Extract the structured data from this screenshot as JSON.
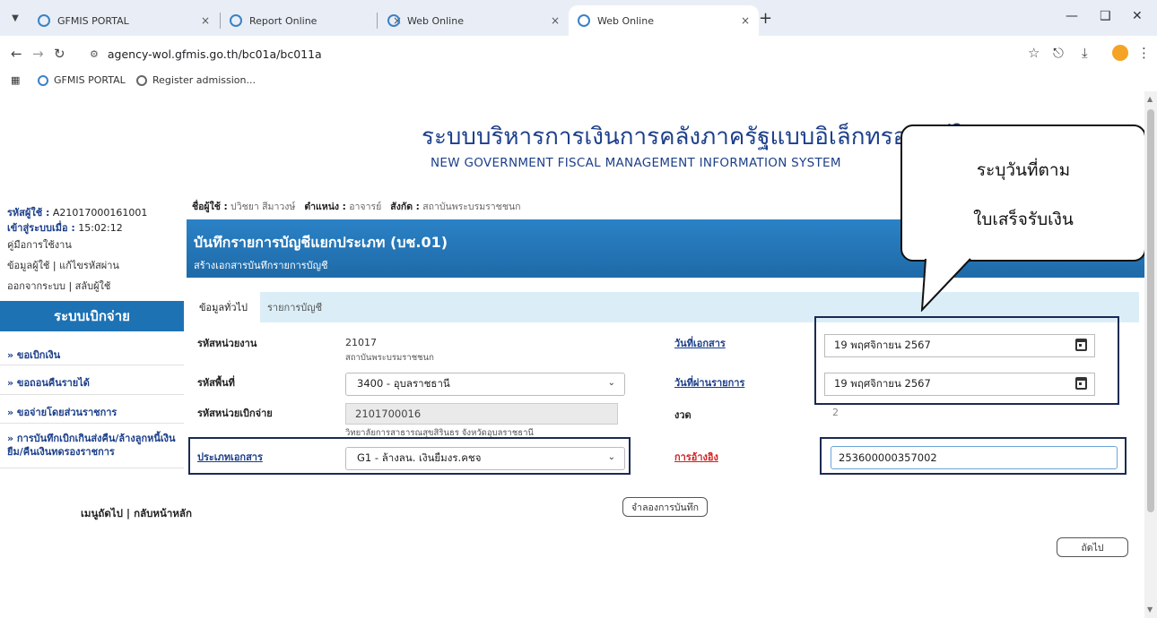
{
  "browser": {
    "tabs": [
      {
        "label": "GFMIS PORTAL",
        "active": false
      },
      {
        "label": "Report Online",
        "active": false
      },
      {
        "label": "Web Online",
        "active": false
      },
      {
        "label": "Web Online",
        "active": true
      }
    ],
    "close_glyph": "×",
    "new_tab_glyph": "+",
    "url": "agency-wol.gfmis.go.th/bc01a/bc011a",
    "bookmarks": [
      "GFMIS PORTAL",
      "Register admission..."
    ]
  },
  "header": {
    "title_th": "ระบบบริหารการเงินการคลังภาครัฐแบบอิเล็กทรอนิกส์ใหม่",
    "title_en": "NEW GOVERNMENT FISCAL MANAGEMENT INFORMATION SYSTEM"
  },
  "sidebar": {
    "user_code_label": "รหัสผู้ใช้ :",
    "user_code": "A21017000161001",
    "login_label": "เข้าสู่ระบบเมื่อ :",
    "login_time": "15:02:12",
    "manual": "คู่มือการใช้งาน",
    "profile": "ข้อมูลผู้ใช้",
    "change_password": "แก้ไขรหัสผ่าน",
    "logout": "ออกจากระบบ",
    "switch_user": "สลับผู้ใช้",
    "section_title": "ระบบเบิกจ่าย",
    "items": [
      "» ขอเบิกเงิน",
      "» ขอถอนคืนรายได้",
      "» ขอจ่ายโดยส่วนราชการ",
      "» การบันทึกเบิกเกินส่งคืน/ล้างลูกหนี้เงิน",
      "ยืม/คืนเงินทดรองราชการ"
    ],
    "next_menu": "เมนูถัดไป",
    "home": "กลับหน้าหลัก"
  },
  "userbar": {
    "name_label": "ชื่อผู้ใช้ :",
    "name": "ปวิชยา สีมาวงษ์",
    "position_label": "ตำแหน่ง :",
    "position": "อาจารย์",
    "affiliation_label": "สังกัด :",
    "affiliation": "สถาบันพระบรมราชชนก"
  },
  "page": {
    "title": "บันทึกรายการบัญชีแยกประเภท (บช.01)",
    "subtitle": "สร้างเอกสารบันทึกรายการบัญชี",
    "tabs": [
      "ข้อมูลทั่วไป",
      "รายการบัญชี"
    ]
  },
  "form": {
    "agency_code_label": "รหัสหน่วยงาน",
    "agency_code": "21017",
    "agency_name": "สถาบันพระบรมราชชนก",
    "area_code_label": "รหัสพื้นที่",
    "area_code": "3400 - อุบลราชธานี",
    "disbursing_unit_label": "รหัสหน่วยเบิกจ่าย",
    "disbursing_unit": "2101700016",
    "disbursing_unit_name": "วิทยาลัยการสาธารณสุขสิรินธร จังหวัดอุบลราชธานี",
    "doc_type_label": "ประเภทเอกสาร",
    "doc_type": "G1 - ล้างลน. เงินยืมงร.คชจ",
    "doc_date_label": "วันที่เอกสาร",
    "doc_date": "19 พฤศจิกายน 2567",
    "posting_date_label": "วันที่ผ่านรายการ",
    "posting_date": "19 พฤศจิกายน 2567",
    "period_label": "งวด",
    "period": "2",
    "reference_label": "การอ้างอิง",
    "reference": "253600000357002"
  },
  "buttons": {
    "simulate": "จำลองการบันทึก",
    "next": "ถัดไป"
  },
  "callout": {
    "line1": "ระบุวันที่ตาม",
    "line2": "ใบเสร็จรับเงิน"
  },
  "colors": {
    "brand_blue": "#1d72b4",
    "header_text": "#1c3f8a",
    "reference_label_red": "#d42020"
  }
}
